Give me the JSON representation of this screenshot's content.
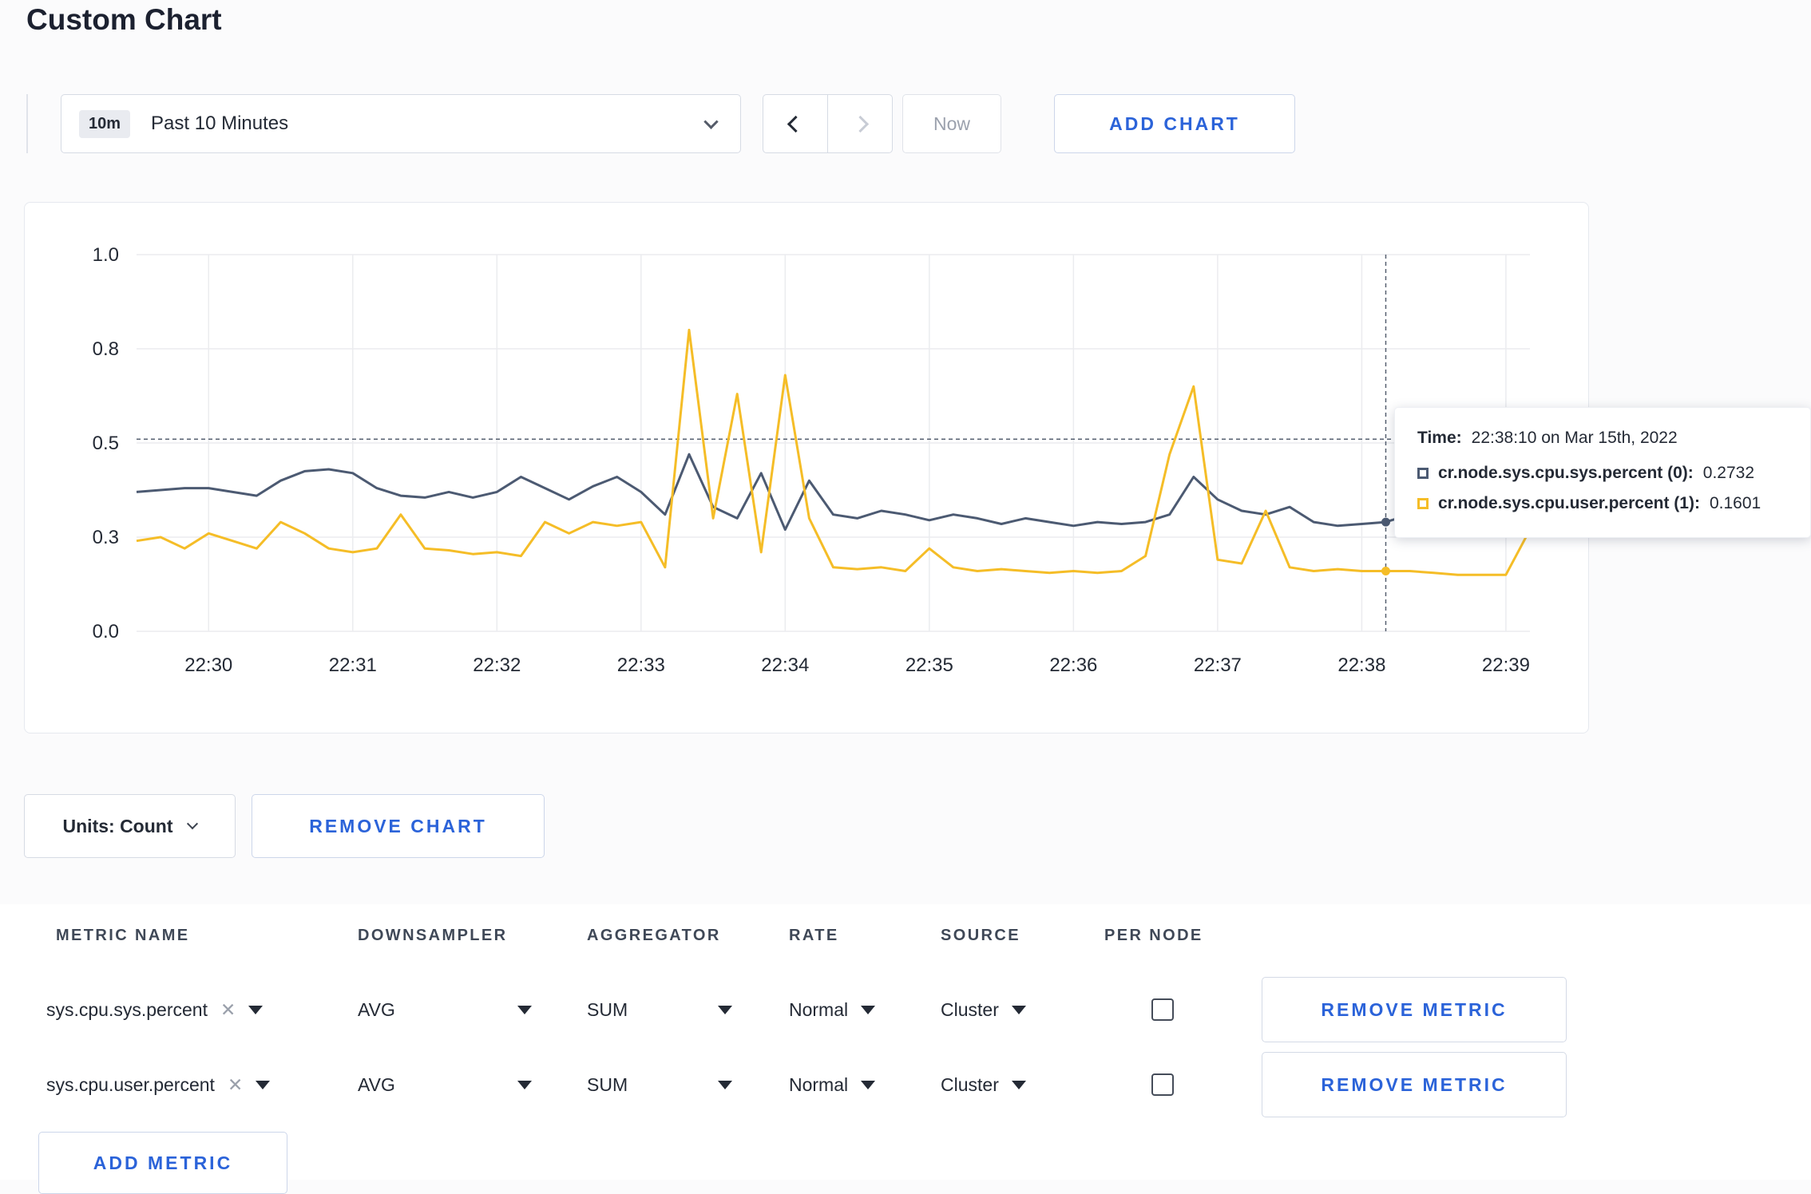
{
  "page": {
    "title": "Custom Chart"
  },
  "toolbar": {
    "time_window_badge": "10m",
    "time_window_label": "Past 10 Minutes",
    "now_label": "Now",
    "add_chart_label": "ADD CHART"
  },
  "icons": {
    "clear": "✕"
  },
  "units": {
    "label": "Units: Count",
    "remove_chart_label": "REMOVE CHART"
  },
  "chart_data": {
    "type": "line",
    "title": "",
    "xlabel": "",
    "ylabel": "",
    "ylim": [
      0,
      1
    ],
    "grid": true,
    "legend_position": "tooltip-only",
    "x_ticks": [
      "22:30",
      "22:31",
      "22:32",
      "22:33",
      "22:34",
      "22:35",
      "22:36",
      "22:37",
      "22:38",
      "22:39"
    ],
    "y_tick_fracs": [
      0,
      0.25,
      0.5,
      0.75,
      1
    ],
    "y_tick_labels": [
      "0.0",
      "0.3",
      "0.5",
      "0.8",
      "1.0"
    ],
    "x_total_seconds": 580,
    "x_tick_first_offset": 30,
    "x_tick_interval": 60,
    "series": [
      {
        "name": "cr.node.sys.cpu.sys.percent",
        "color": "#4c5a72",
        "values": [
          0.37,
          0.375,
          0.38,
          0.38,
          0.37,
          0.36,
          0.4,
          0.425,
          0.43,
          0.42,
          0.38,
          0.36,
          0.355,
          0.37,
          0.355,
          0.37,
          0.41,
          0.38,
          0.35,
          0.385,
          0.41,
          0.37,
          0.31,
          0.47,
          0.33,
          0.3,
          0.42,
          0.27,
          0.4,
          0.31,
          0.3,
          0.32,
          0.31,
          0.295,
          0.31,
          0.3,
          0.285,
          0.3,
          0.29,
          0.28,
          0.29,
          0.285,
          0.29,
          0.31,
          0.41,
          0.35,
          0.32,
          0.31,
          0.33,
          0.29,
          0.28,
          0.285,
          0.29,
          0.31,
          0.32,
          0.3,
          0.3,
          0.305,
          0.31
        ]
      },
      {
        "name": "cr.node.sys.cpu.user.percent",
        "color": "#f5bd27",
        "values": [
          0.24,
          0.25,
          0.22,
          0.26,
          0.24,
          0.22,
          0.29,
          0.26,
          0.22,
          0.21,
          0.22,
          0.31,
          0.22,
          0.215,
          0.205,
          0.21,
          0.2,
          0.29,
          0.26,
          0.29,
          0.28,
          0.29,
          0.17,
          0.8,
          0.3,
          0.63,
          0.21,
          0.68,
          0.3,
          0.17,
          0.165,
          0.17,
          0.16,
          0.22,
          0.17,
          0.16,
          0.165,
          0.16,
          0.155,
          0.16,
          0.155,
          0.16,
          0.2,
          0.47,
          0.65,
          0.19,
          0.18,
          0.32,
          0.17,
          0.16,
          0.165,
          0.16,
          0.16,
          0.16,
          0.155,
          0.15,
          0.15,
          0.15,
          0.27
        ]
      }
    ],
    "crosshair": {
      "time_offset_seconds": 520,
      "y_value": 0.51
    },
    "tooltip": {
      "time_label": "Time:",
      "time_value": "22:38:10 on Mar 15th, 2022",
      "entries": [
        {
          "name": "cr.node.sys.cpu.sys.percent (0):",
          "value": "0.2732"
        },
        {
          "name": "cr.node.sys.cpu.user.percent (1):",
          "value": "0.1601"
        }
      ]
    }
  },
  "table": {
    "headers": [
      "METRIC NAME",
      "DOWNSAMPLER",
      "AGGREGATOR",
      "RATE",
      "SOURCE",
      "PER NODE"
    ],
    "rows": [
      {
        "metric": "sys.cpu.sys.percent",
        "downsampler": "AVG",
        "aggregator": "SUM",
        "rate": "Normal",
        "source": "Cluster",
        "per_node_checked": false,
        "remove_label": "REMOVE METRIC"
      },
      {
        "metric": "sys.cpu.user.percent",
        "downsampler": "AVG",
        "aggregator": "SUM",
        "rate": "Normal",
        "source": "Cluster",
        "per_node_checked": false,
        "remove_label": "REMOVE METRIC"
      }
    ],
    "add_metric_label": "ADD METRIC"
  }
}
